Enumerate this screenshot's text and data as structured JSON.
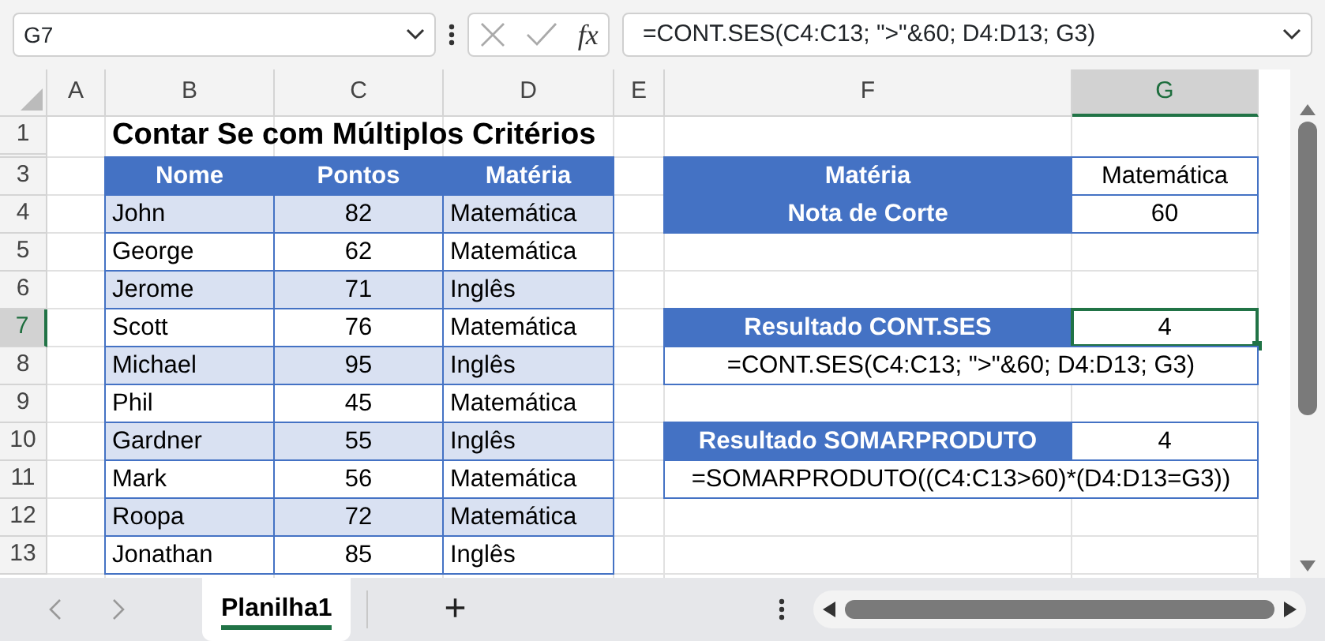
{
  "name_box": "G7",
  "formula_bar": "=CONT.SES(C4:C13; \">\"&60; D4:D13; G3)",
  "fx_label": "fx",
  "column_headers": [
    "A",
    "B",
    "C",
    "D",
    "E",
    "F",
    "G"
  ],
  "row_headers": [
    "1",
    "3",
    "4",
    "5",
    "6",
    "7",
    "8",
    "9",
    "10",
    "11",
    "12",
    "13"
  ],
  "title": "Contar Se com Múltiplos Critérios",
  "data_table": {
    "columns": [
      "Nome",
      "Pontos",
      "Matéria"
    ],
    "rows": [
      {
        "cells": [
          "John",
          "82",
          "Matemática"
        ],
        "shaded": true
      },
      {
        "cells": [
          "George",
          "62",
          "Matemática"
        ],
        "shaded": false
      },
      {
        "cells": [
          "Jerome",
          "71",
          "Inglês"
        ],
        "shaded": true
      },
      {
        "cells": [
          "Scott",
          "76",
          "Matemática"
        ],
        "shaded": false
      },
      {
        "cells": [
          "Michael",
          "95",
          "Inglês"
        ],
        "shaded": true
      },
      {
        "cells": [
          "Phil",
          "45",
          "Matemática"
        ],
        "shaded": false
      },
      {
        "cells": [
          "Gardner",
          "55",
          "Inglês"
        ],
        "shaded": true
      },
      {
        "cells": [
          "Mark",
          "56",
          "Matemática"
        ],
        "shaded": false
      },
      {
        "cells": [
          "Roopa",
          "72",
          "Matemática"
        ],
        "shaded": true
      },
      {
        "cells": [
          "Jonathan",
          "85",
          "Inglês"
        ],
        "shaded": false
      }
    ]
  },
  "criteria": [
    {
      "label": "Matéria",
      "value": "Matemática"
    },
    {
      "label": "Nota de Corte",
      "value": "60"
    }
  ],
  "results": [
    {
      "label": "Resultado CONT.SES",
      "value": "4",
      "formula": "=CONT.SES(C4:C13; \">\"&60; D4:D13; G3)",
      "selected": true
    },
    {
      "label": "Resultado SOMARPRODUTO",
      "value": "4",
      "formula": "=SOMARPRODUTO((C4:C13>60)*(D4:D13=G3))",
      "selected": false
    }
  ],
  "sheet_tabs": [
    {
      "label": "Planilha1",
      "selected": true
    }
  ],
  "add_sheet": "+"
}
